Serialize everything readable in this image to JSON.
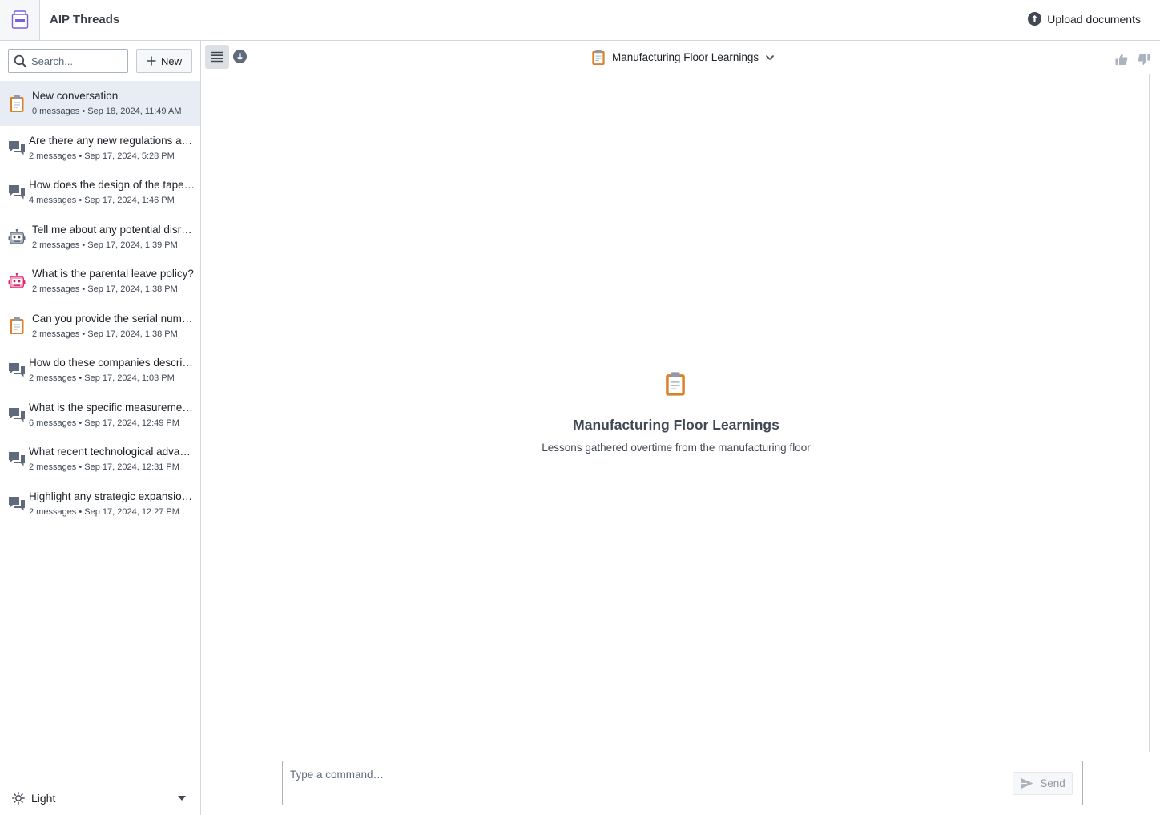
{
  "header": {
    "app_title": "AIP Threads",
    "upload_label": "Upload documents"
  },
  "sidebar": {
    "search_placeholder": "Search...",
    "new_label": "New",
    "threads": [
      {
        "title": "New conversation",
        "meta": "0 messages • Sep 18, 2024, 11:49 AM",
        "icon": "clipboard-icon",
        "selected": true
      },
      {
        "title": "Are there any new regulations ap…",
        "meta": "2 messages • Sep 17, 2024, 5:28 PM",
        "icon": "chat-icon"
      },
      {
        "title": "How does the design of the taper …",
        "meta": "4 messages • Sep 17, 2024, 1:46 PM",
        "icon": "chat-icon"
      },
      {
        "title": "Tell me about any potential disr…",
        "meta": "2 messages • Sep 17, 2024, 1:39 PM",
        "icon": "robot-icon"
      },
      {
        "title": "What is the parental leave policy?",
        "meta": "2 messages • Sep 17, 2024, 1:38 PM",
        "icon": "robot-pink-icon"
      },
      {
        "title": "Can you provide the serial numb…",
        "meta": "2 messages • Sep 17, 2024, 1:38 PM",
        "icon": "clipboard-icon"
      },
      {
        "title": "How do these companies describ…",
        "meta": "2 messages • Sep 17, 2024, 1:03 PM",
        "icon": "chat-icon"
      },
      {
        "title": "What is the specific measuremen…",
        "meta": "6 messages • Sep 17, 2024, 12:49 PM",
        "icon": "chat-icon"
      },
      {
        "title": "What recent technological advan…",
        "meta": "2 messages • Sep 17, 2024, 12:31 PM",
        "icon": "chat-icon"
      },
      {
        "title": "Highlight any strategic expansion…",
        "meta": "2 messages • Sep 17, 2024, 12:27 PM",
        "icon": "chat-icon"
      }
    ],
    "theme_label": "Light"
  },
  "main": {
    "document_name": "Manufacturing Floor Learnings",
    "empty_title": "Manufacturing Floor Learnings",
    "empty_description": "Lessons gathered overtime from the manufacturing floor",
    "composer_placeholder": "Type a command…",
    "send_label": "Send"
  },
  "colors": {
    "selected_row": "#e7ecf5",
    "clipboard_orange": "#d9822b",
    "robot_pink": "#db2c6f",
    "icon_gray": "#5f6b7c"
  }
}
